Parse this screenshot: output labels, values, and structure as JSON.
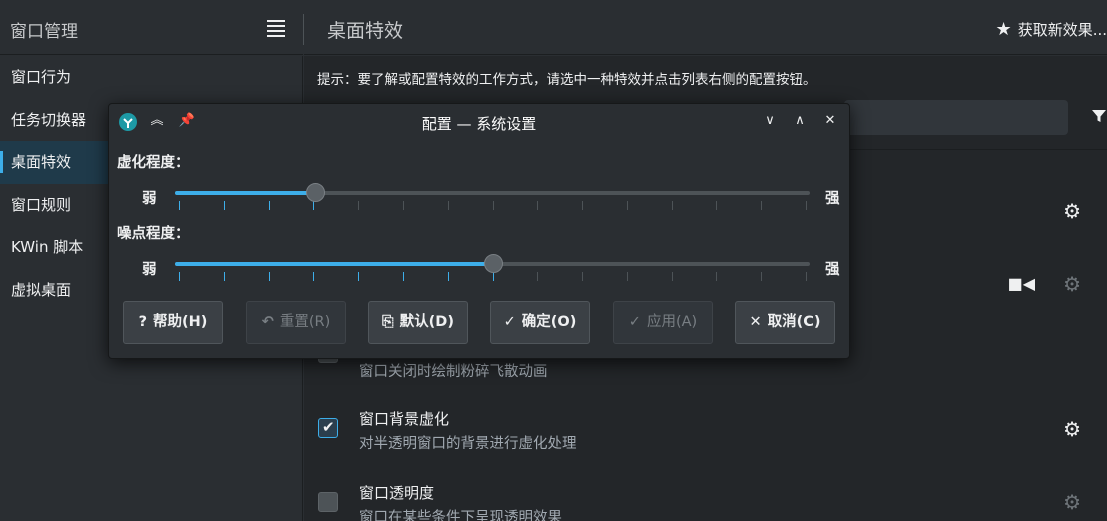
{
  "sidebar": {
    "title": "窗口管理",
    "items": [
      {
        "label": "窗口行为"
      },
      {
        "label": "任务切换器"
      },
      {
        "label": "桌面特效"
      },
      {
        "label": "窗口规则"
      },
      {
        "label": "KWin 脚本"
      },
      {
        "label": "虚拟桌面"
      }
    ],
    "active_index": 2
  },
  "header": {
    "title": "桌面特效",
    "get_new_label": "获取新效果..."
  },
  "content": {
    "hint": "提示：要了解或配置特效的工作方式，请选中一种特效并点击列表右侧的配置按钮。",
    "effects": [
      {
        "desc": "窗口关闭时绘制粉碎飞散动画"
      },
      {
        "name": "窗口背景虚化",
        "desc": "对半透明窗口的背景进行虚化处理",
        "checked": true
      },
      {
        "name": "窗口透明度",
        "desc": "窗口在某些条件下呈现透明效果",
        "checked": false
      }
    ]
  },
  "dialog": {
    "title": "配置 — 系统设置",
    "blur_label": "虚化程度：",
    "noise_label": "噪点程度：",
    "weak_label": "弱",
    "strong_label": "强",
    "blur_level": 0.22,
    "noise_level": 0.5,
    "buttons": {
      "help": "帮助(H)",
      "reset": "重置(R)",
      "defaults": "默认(D)",
      "ok": "确定(O)",
      "apply": "应用(A)",
      "cancel": "取消(C)"
    }
  },
  "colors": {
    "accent": "#3daee9",
    "window_bg": "#2a2e32",
    "view_bg": "#232629"
  }
}
